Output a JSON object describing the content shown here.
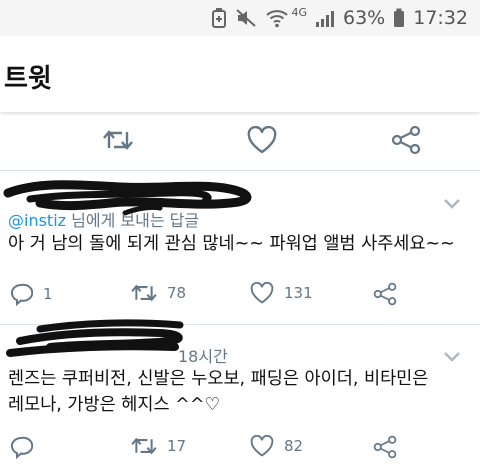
{
  "status_bar": {
    "network": "4G",
    "battery": "63%",
    "time": "17:32"
  },
  "header": {
    "title": "트윗"
  },
  "replies": [
    {
      "reply_to_handle": "@instiz",
      "reply_to_text": " 님에게 보내는 답글",
      "text": "아 거 남의 돌에 되게 관심 많네~~ 파워업 앨범 사주세요~~",
      "reply_count": "1",
      "retweet_count": "78",
      "like_count": "131"
    },
    {
      "time": "18시간",
      "text_line1": "렌즈는 쿠퍼비전, 신발은 누오보, 패딩은 아이더, 비타민은",
      "text_line2": "레모나, 가방은 헤지스 ^^♡",
      "retweet_count": "17",
      "like_count": "82"
    }
  ],
  "colors": {
    "link": "#1b95e0",
    "icon": "#657786",
    "text": "#14171a"
  }
}
